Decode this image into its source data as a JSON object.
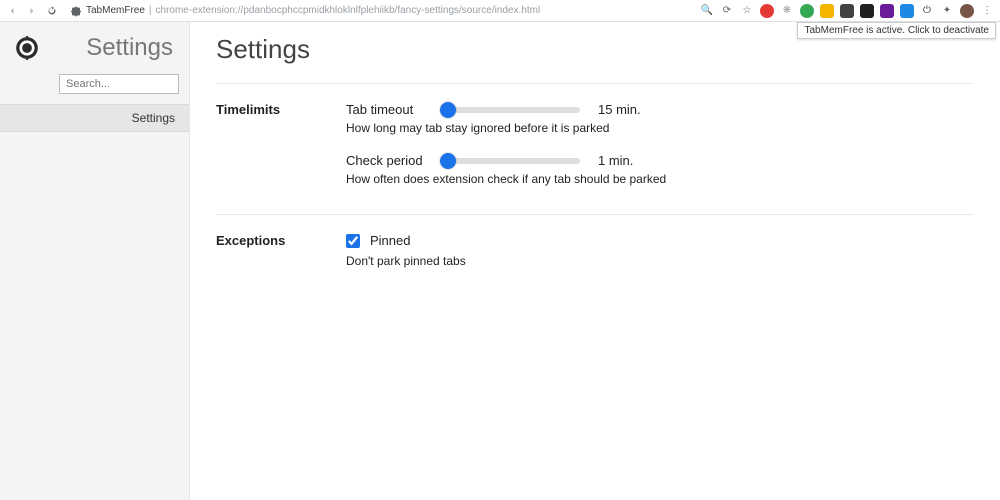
{
  "chrome": {
    "tab_title": "TabMemFree",
    "url": "chrome-extension://pdanbocphccpmidkhloklnlfplehiikb/fancy-settings/source/index.html",
    "tooltip": "TabMemFree is active. Click to deactivate"
  },
  "sidebar": {
    "title": "Settings",
    "search_placeholder": "Search...",
    "items": [
      {
        "label": "Settings"
      }
    ]
  },
  "page": {
    "title": "Settings",
    "sections": {
      "timelimits": {
        "heading": "Timelimits",
        "tab_timeout": {
          "label": "Tab timeout",
          "value_text": "15 min.",
          "desc": "How long may tab stay ignored before it is parked"
        },
        "check_period": {
          "label": "Check period",
          "value_text": "1 min.",
          "desc": "How often does extension check if any tab should be parked"
        }
      },
      "exceptions": {
        "heading": "Exceptions",
        "pinned": {
          "label": "Pinned",
          "checked": true,
          "desc": "Don't park pinned tabs"
        }
      }
    }
  }
}
